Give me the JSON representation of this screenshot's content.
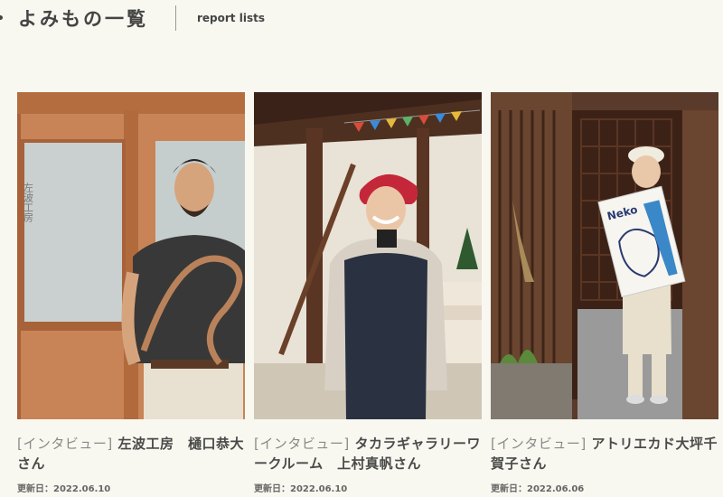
{
  "header": {
    "title": "よみもの一覧",
    "subtitle": "report lists"
  },
  "cards": [
    {
      "tag": "[インタビュー]",
      "title": "左波工房　樋口恭大さん",
      "date_label": "更新日：",
      "date": "2022.06.10",
      "sign_text": "左波工房"
    },
    {
      "tag": "[インタビュー]",
      "title": "タカラギャラリーワークルーム　上村真帆さん",
      "date_label": "更新日：",
      "date": "2022.06.10"
    },
    {
      "tag": "[インタビュー]",
      "title": "アトリエカド大坪千賀子さん",
      "date_label": "更新日：",
      "date": "2022.06.06",
      "sign_text": "Neko"
    }
  ],
  "colors": {
    "background": "#f8f8f0",
    "wood": "#c07a4a",
    "dark_wood": "#4a2a1a"
  }
}
